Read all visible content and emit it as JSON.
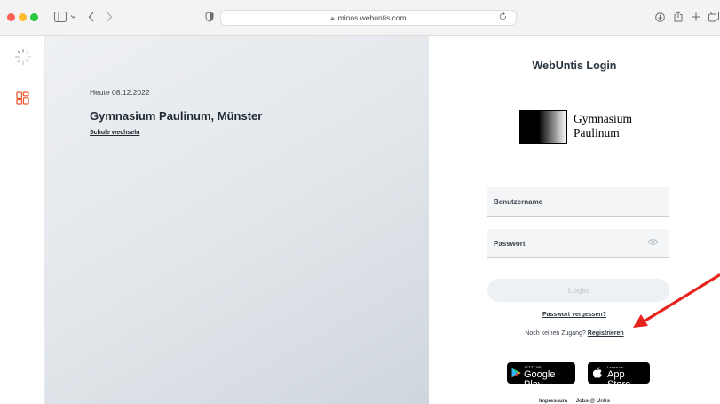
{
  "browser": {
    "url": "minos.webuntis.com",
    "icons": [
      "sidebar-icon",
      "chevron-down-icon",
      "back-icon",
      "forward-icon",
      "shield-icon",
      "lock-icon",
      "reload-icon",
      "download-icon",
      "share-icon",
      "new-tab-icon",
      "tabs-icon"
    ]
  },
  "left": {
    "today": "Heute 08.12.2022",
    "school_name": "Gymnasium Paulinum, Münster",
    "switch_school": "Schule wechseln"
  },
  "login": {
    "title": "WebUntis Login",
    "logo_line1": "Gymnasium",
    "logo_line2": "Paulinum",
    "username_label": "Benutzername",
    "password_label": "Passwort",
    "login_button": "Login",
    "forgot_password": "Passwort vergessen?",
    "no_access": "Noch keinen Zugang?",
    "register": "Registrieren",
    "google_small": "JETZT BEI",
    "google_big": "Google Play",
    "apple_small": "Laden im",
    "apple_big": "App Store",
    "footer_imprint": "Impressum",
    "footer_jobs": "Jobs @ Untis"
  },
  "colors": {
    "accent_arrow": "#e8231e",
    "traffic_red": "#fe5f57",
    "traffic_yellow": "#febc2e",
    "traffic_green": "#28c840",
    "sidebar_icon": "#e8552a"
  }
}
